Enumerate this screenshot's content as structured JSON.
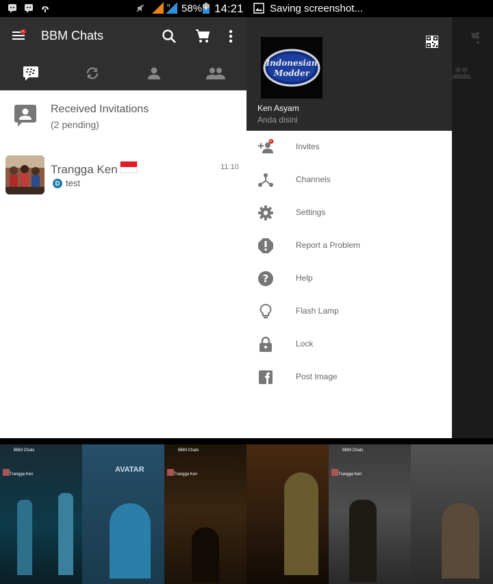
{
  "status_left": {
    "battery_pct": "58%",
    "clock": "14:21",
    "icons": [
      "bbm-notification-icon",
      "bbm-notification-icon",
      "upload-icon",
      "mute-icon",
      "signal-icon",
      "signal-icon",
      "battery-icon"
    ]
  },
  "status_right": {
    "saving_text": "Saving screenshot...",
    "icons": [
      "image-icon"
    ]
  },
  "toolbar": {
    "title": "BBM Chats",
    "icons": [
      "menu-icon",
      "search-icon",
      "cart-icon",
      "more-vert-icon"
    ]
  },
  "tabs": [
    "bbm-chats-tab",
    "updates-tab",
    "contacts-tab",
    "groups-tab"
  ],
  "invitations": {
    "title": "Received Invitations",
    "subtitle": "(2 pending)"
  },
  "chat": {
    "name": "Trangga Ken",
    "time": "11:10",
    "status_badge": "D",
    "message": "test"
  },
  "drawer": {
    "logo_text_1": "Indonesian",
    "logo_text_2": "Modder",
    "user_name": "Ken Asyam",
    "user_status": "Anda disini",
    "items": [
      {
        "label": "Invites",
        "icon": "add-person-icon"
      },
      {
        "label": "Channels",
        "icon": "channels-icon"
      },
      {
        "label": "Settings",
        "icon": "gear-icon"
      },
      {
        "label": "Report a Problem",
        "icon": "alert-icon"
      },
      {
        "label": "Help",
        "icon": "help-icon"
      },
      {
        "label": "Flash Lamp",
        "icon": "bulb-icon"
      },
      {
        "label": "Lock",
        "icon": "lock-icon"
      },
      {
        "label": "Post Image",
        "icon": "facebook-icon"
      }
    ]
  },
  "thumbnails": [
    {
      "theme": "AVATAR",
      "title": "BBM Chats",
      "chat": "Trangga Ken"
    },
    {
      "theme": "",
      "title": "BBM Chats",
      "chat": "Trangga Ken"
    },
    {
      "theme": "",
      "title": "BBM Chats",
      "chat": "Trangga Ken"
    }
  ],
  "colors": {
    "toolbar": "#2f2f2f",
    "drawer_header": "#2a2a2a",
    "accent_badge": "#1f7aa6",
    "flag_red": "#e31b23"
  }
}
